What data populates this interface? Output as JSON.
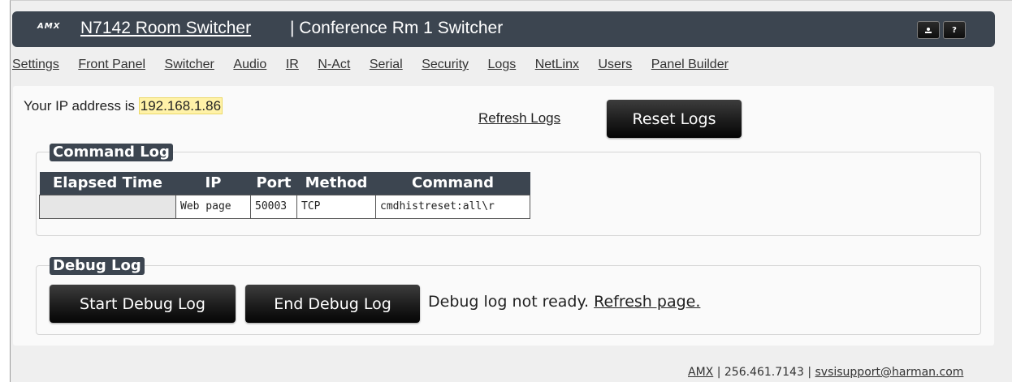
{
  "header": {
    "logo": "AMX",
    "device_link": "N7142 Room Switcher",
    "title_suffix": "| Conference Rm 1 Switcher",
    "user_button_icon": "user-icon",
    "help_button_label": "?"
  },
  "nav": {
    "items": [
      "Settings",
      "Front Panel",
      "Switcher",
      "Audio",
      "IR",
      "N-Act",
      "Serial",
      "Security",
      "Logs",
      "NetLinx",
      "Users",
      "Panel Builder"
    ]
  },
  "main": {
    "ip_prefix": "Your IP address is",
    "ip_address": "192.168.1.86",
    "refresh_logs": "Refresh Logs",
    "reset_logs": "Reset Logs"
  },
  "command_log": {
    "legend": "Command Log",
    "columns": [
      "Elapsed Time",
      "IP",
      "Port",
      "Method",
      "Command"
    ],
    "rows": [
      [
        "",
        "Web page",
        "50003",
        "TCP",
        "cmdhistreset:all\\r"
      ]
    ]
  },
  "debug_log": {
    "legend": "Debug Log",
    "start_button": "Start Debug Log",
    "end_button": "End Debug Log",
    "status_text": "Debug log not ready.",
    "refresh_link": "Refresh page."
  },
  "footer": {
    "brand_link": "AMX",
    "separator": "|",
    "phone": "256.461.7143",
    "email": "svsisupport@harman.com"
  },
  "colors": {
    "header_bg": "#3c4550",
    "ip_highlight": "#fff2a8",
    "button_dark": "#1c1c1c"
  }
}
